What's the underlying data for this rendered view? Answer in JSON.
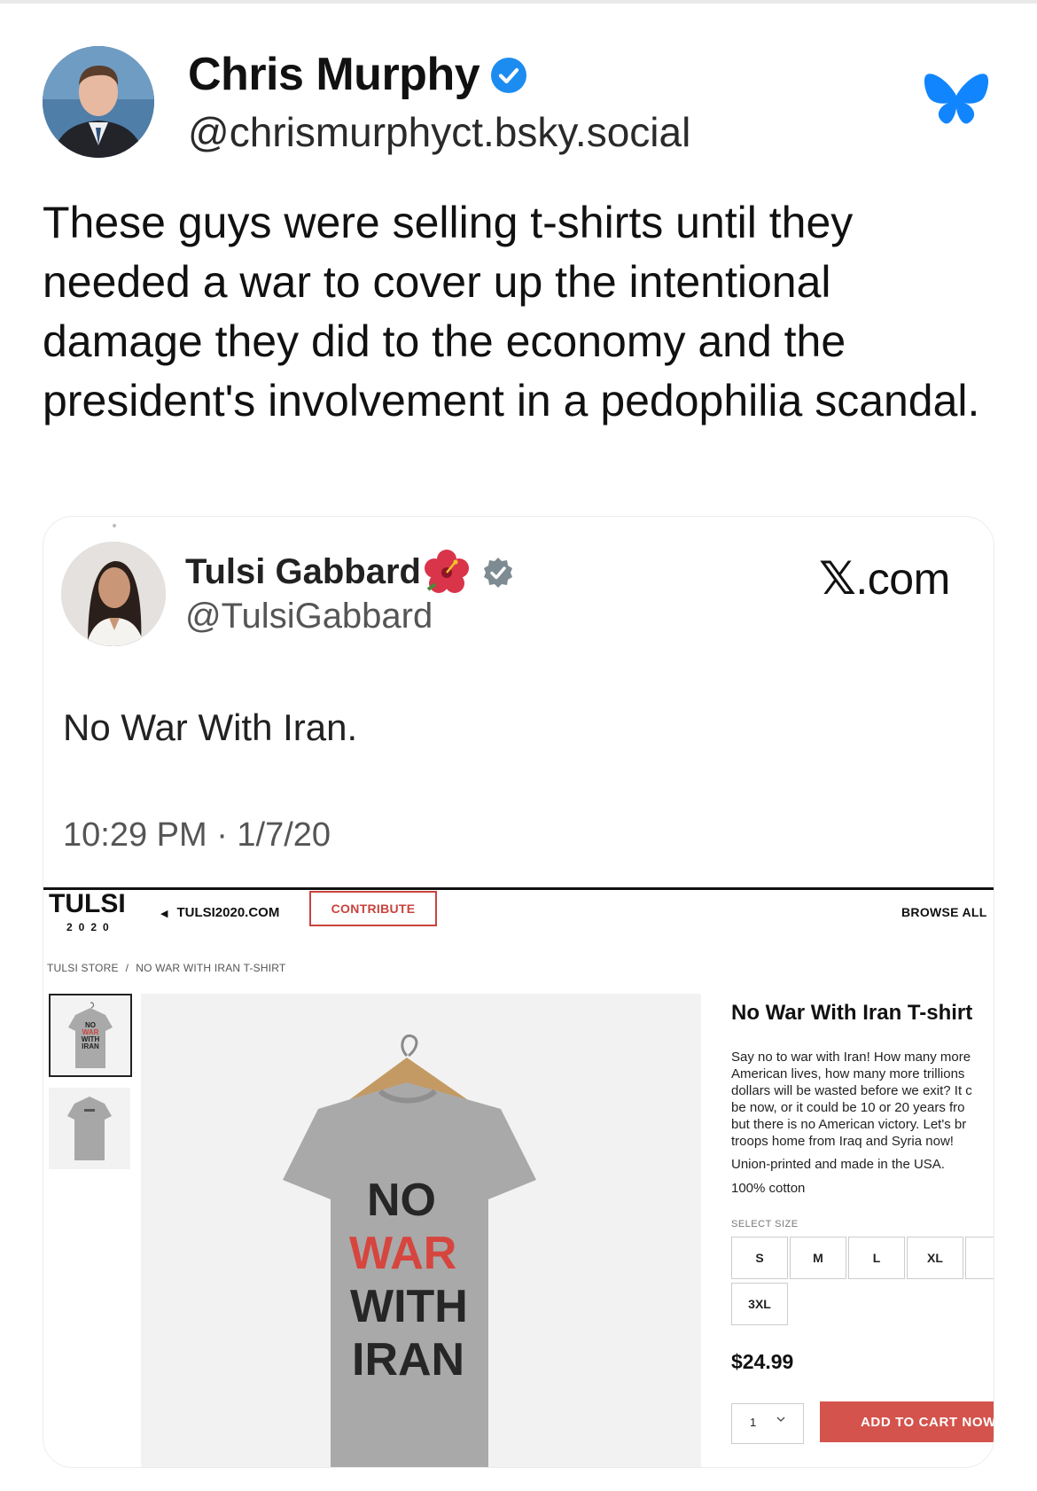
{
  "post": {
    "author_name": "Chris Murphy",
    "author_handle": "@chrismurphyct.bsky.social",
    "text": "These guys were selling t-shirts until they needed a war to cover up the intentional damage they did to the economy and the president's involvement in a pedophilia scandal."
  },
  "embed": {
    "name": "Tulsi Gabbard",
    "handle": "@TulsiGabbard",
    "source": ".com",
    "source_logo": "𝕏",
    "tweet": "No War With Iran.",
    "timestamp": "10:29 PM · 1/7/20",
    "store": {
      "logo": "TULSI",
      "logo_year": "2020",
      "back_link": "TULSI2020.COM",
      "contribute": "CONTRIBUTE",
      "browse_all": "BROWSE ALL",
      "breadcrumb": [
        "TULSI STORE",
        "NO WAR WITH IRAN T-SHIRT"
      ],
      "breadcrumb_sep": "/",
      "product_title": "No War With Iran T-shirt",
      "description_lines": [
        "Say no to war with Iran! How many more",
        "American lives, how many more trillions",
        "dollars will be wasted before we exit? It c",
        "be now, or it could be 10 or 20 years fro",
        "but there is no American victory. Let's br",
        "troops home from Iraq and Syria now!"
      ],
      "note1": "Union-printed and made in the USA.",
      "note2": "100% cotton",
      "select_size_label": "SELECT SIZE",
      "sizes": [
        "S",
        "M",
        "L",
        "XL",
        "3XL"
      ],
      "price": "$24.99",
      "quantity": "1",
      "add_to_cart": "ADD TO CART NOW",
      "shirt_text": [
        "NO",
        "WAR",
        "WITH",
        "IRAN"
      ],
      "thumb_text": [
        "NO",
        "WAR",
        "WITH",
        "IRAN"
      ]
    }
  },
  "colors": {
    "verified_blue": "#1d8cf0",
    "bluesky_blue": "#1185fe",
    "store_red": "#d4534c",
    "shirt_gray": "#a9a9a9"
  },
  "icons": [
    "verified-icon",
    "bluesky-butterfly-icon",
    "hibiscus-icon",
    "x-verified-icon",
    "chevron-down-icon"
  ]
}
